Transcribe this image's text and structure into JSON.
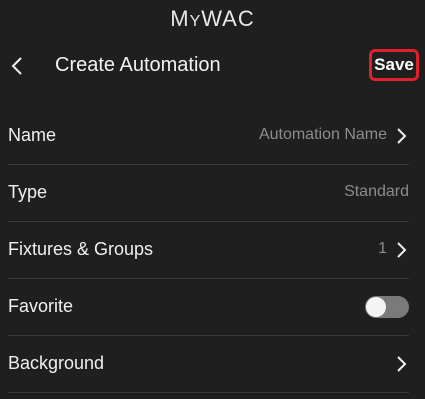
{
  "app": {
    "brand_main": "M",
    "brand_small": "Y",
    "brand_rest": "WAC"
  },
  "header": {
    "title": "Create Automation",
    "save_label": "Save",
    "back_icon": "chevron-left-icon"
  },
  "rows": [
    {
      "label": "Name",
      "value": "Automation Name",
      "chevron": true
    },
    {
      "label": "Type",
      "value": "Standard",
      "chevron": false
    },
    {
      "label": "Fixtures & Groups",
      "value": "1",
      "chevron": true
    },
    {
      "label": "Favorite",
      "toggle": false
    },
    {
      "label": "Background",
      "value": "",
      "chevron": true
    }
  ],
  "colors": {
    "background": "#1f1f1f",
    "save_outline": "#e0202a",
    "muted_text": "#8c8c8c"
  }
}
